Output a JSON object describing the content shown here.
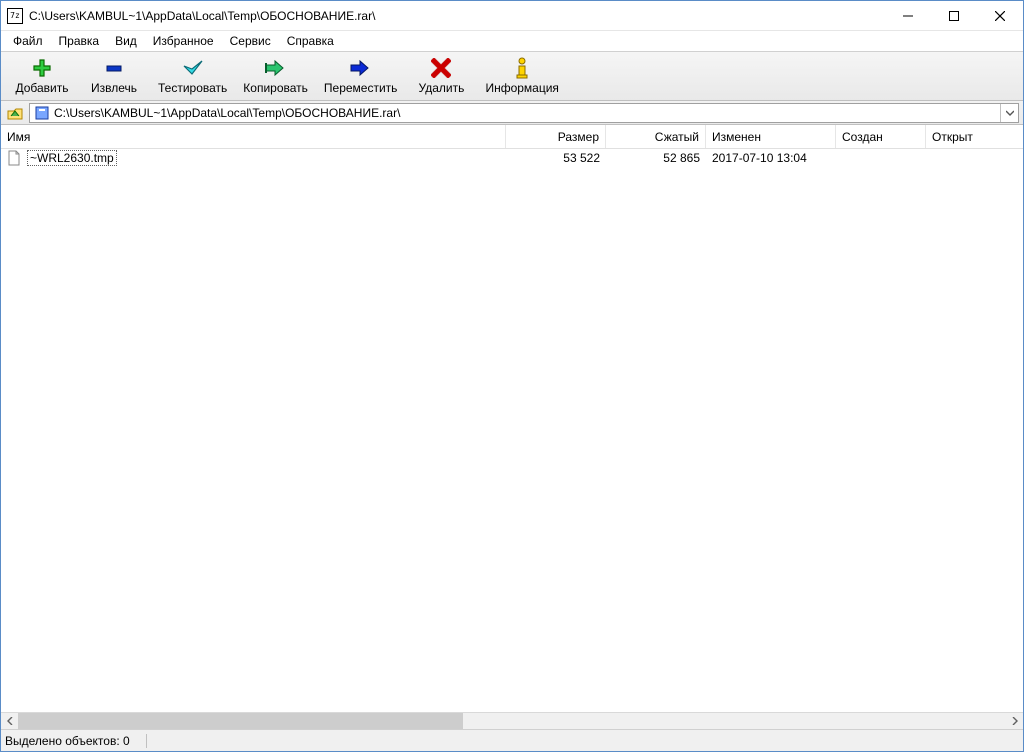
{
  "window": {
    "title": "C:\\Users\\KAMBUL~1\\AppData\\Local\\Temp\\ОБОСНОВАНИЕ.rar\\",
    "app_icon_text": "7z"
  },
  "menu": {
    "file": "Файл",
    "edit": "Правка",
    "view": "Вид",
    "favorites": "Избранное",
    "tools": "Сервис",
    "help": "Справка"
  },
  "toolbar": {
    "add": "Добавить",
    "extract": "Извлечь",
    "test": "Тестировать",
    "copy": "Копировать",
    "move": "Переместить",
    "delete": "Удалить",
    "info": "Информация"
  },
  "address": {
    "path": "C:\\Users\\KAMBUL~1\\AppData\\Local\\Temp\\ОБОСНОВАНИЕ.rar\\"
  },
  "columns": {
    "name": "Имя",
    "size": "Размер",
    "packed": "Сжатый",
    "modified": "Изменен",
    "created": "Создан",
    "opened": "Открыт"
  },
  "files": [
    {
      "name": "~WRL2630.tmp",
      "size": "53 522",
      "packed": "52 865",
      "modified": "2017-07-10 13:04",
      "created": "",
      "opened": ""
    }
  ],
  "status": {
    "selection": "Выделено объектов: 0"
  }
}
